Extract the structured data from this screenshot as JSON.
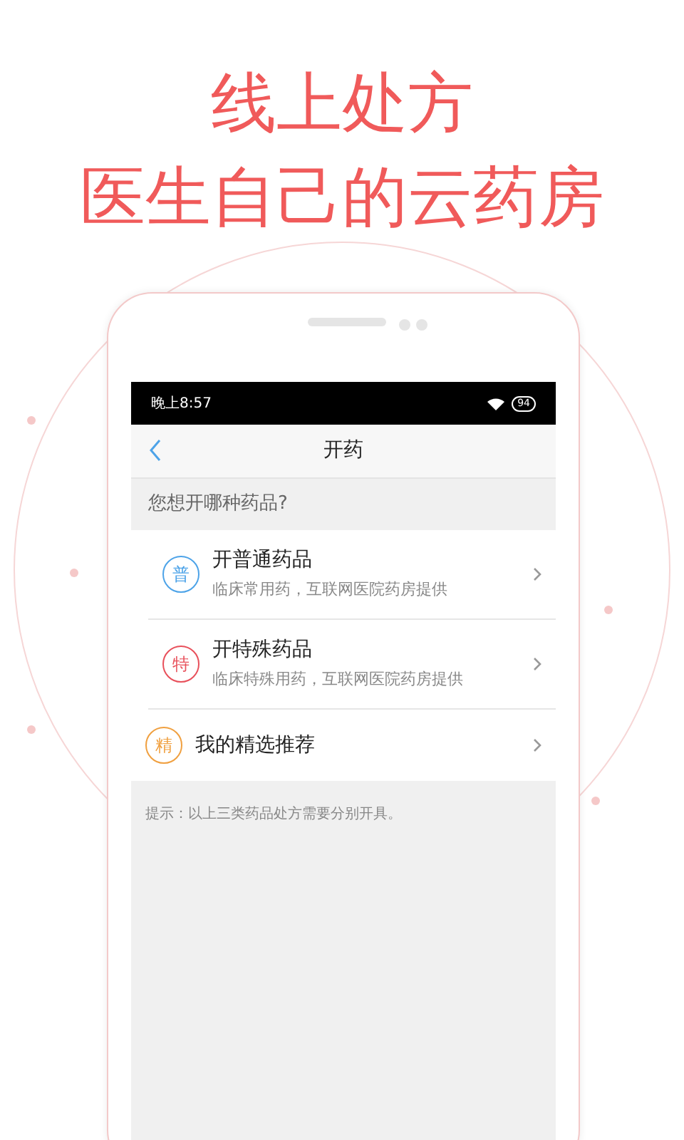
{
  "headline": [
    "线上处方",
    "医生自己的云药房"
  ],
  "status_bar": {
    "time": "晚上8:57",
    "battery": "94"
  },
  "nav": {
    "title": "开药"
  },
  "section_title": "您想开哪种药品?",
  "options": [
    {
      "badge": "普",
      "color": "#4da3e8",
      "title": "开普通药品",
      "subtitle": "临床常用药，互联网医院药房提供"
    },
    {
      "badge": "特",
      "color": "#e8505b",
      "title": "开特殊药品",
      "subtitle": "临床特殊用药，互联网医院药房提供"
    },
    {
      "badge": "精",
      "color": "#f0a040",
      "title": "我的精选推荐"
    }
  ],
  "hint": "提示：以上三类药品处方需要分别开具。"
}
